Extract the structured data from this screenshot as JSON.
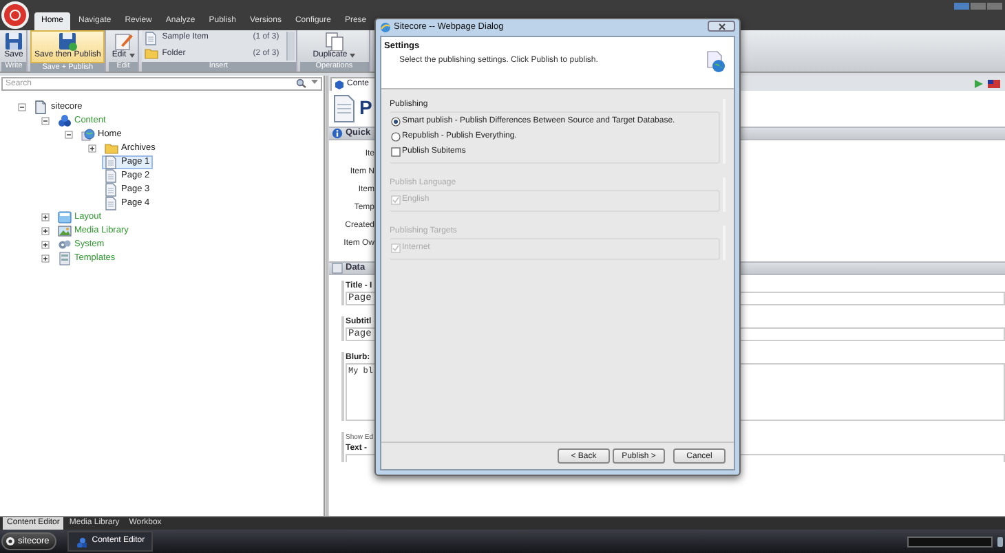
{
  "menu_tabs": [
    {
      "label": "Home",
      "selected": true
    },
    {
      "label": "Navigate",
      "selected": false
    },
    {
      "label": "Review",
      "selected": false
    },
    {
      "label": "Analyze",
      "selected": false
    },
    {
      "label": "Publish",
      "selected": false
    },
    {
      "label": "Versions",
      "selected": false
    },
    {
      "label": "Configure",
      "selected": false
    },
    {
      "label": "Prese",
      "selected": false
    }
  ],
  "ribbon": {
    "groups": [
      {
        "label": "Write",
        "kind": "large",
        "buttons": [
          {
            "label": "Save",
            "kind": "save",
            "highlighted": false
          }
        ]
      },
      {
        "label": "Save + Publish",
        "kind": "large",
        "buttons": [
          {
            "label": "Save then Publish",
            "kind": "savepublish",
            "highlighted": true
          }
        ]
      },
      {
        "label": "Edit",
        "kind": "large",
        "buttons": [
          {
            "label": "Edit",
            "kind": "edit",
            "highlighted": false
          }
        ]
      },
      {
        "label": "Insert",
        "kind": "list",
        "buttons": [
          {
            "label": "Sample Item",
            "count": "(1 of 3)",
            "kind": "page"
          },
          {
            "label": "Folder",
            "count": "(2 of 3)",
            "kind": "folder"
          }
        ]
      },
      {
        "label": "Operations",
        "kind": "large",
        "buttons": [
          {
            "label": "Duplicate",
            "kind": "duplicate",
            "highlighted": false
          }
        ]
      }
    ]
  },
  "search": {
    "placeholder": "Search"
  },
  "tree": [
    {
      "label": "sitecore",
      "kind": "root",
      "selected": false,
      "expanded": true,
      "children": [
        {
          "label": "Content",
          "kind": "content",
          "selected": false,
          "expanded": true,
          "children": [
            {
              "label": "Home",
              "kind": "home",
              "selected": false,
              "expanded": true,
              "children": [
                {
                  "label": "Archives",
                  "kind": "folder",
                  "selected": false,
                  "expanded": false
                },
                {
                  "label": "Page 1",
                  "kind": "page",
                  "selected": true
                },
                {
                  "label": "Page 2",
                  "kind": "page",
                  "selected": false
                },
                {
                  "label": "Page 3",
                  "kind": "page",
                  "selected": false
                },
                {
                  "label": "Page 4",
                  "kind": "page",
                  "selected": false
                }
              ]
            }
          ]
        },
        {
          "label": "Layout",
          "kind": "layout",
          "selected": false,
          "expanded": false
        },
        {
          "label": "Media Library",
          "kind": "media",
          "selected": false,
          "expanded": false
        },
        {
          "label": "System",
          "kind": "system",
          "selected": false,
          "expanded": false
        },
        {
          "label": "Templates",
          "kind": "templates",
          "selected": false,
          "expanded": false
        }
      ]
    }
  ],
  "editor": {
    "tab": "Conte",
    "item_title": "P",
    "quick_info": {
      "title": "Quick",
      "labels": [
        "Ite",
        "Item N",
        "Item",
        "Temp",
        "Created",
        "Item Ow"
      ]
    },
    "data": {
      "title": "Data",
      "fields": [
        {
          "kind": "text",
          "label": "Title - I",
          "value": "Page"
        },
        {
          "kind": "text",
          "label": "Subtitl",
          "value": "Page"
        },
        {
          "kind": "textarea",
          "label": "Blurb:",
          "value": "My bl"
        },
        {
          "kind": "rich",
          "note": "Show Ed",
          "label": "Text - "
        }
      ]
    }
  },
  "dialog": {
    "title": "Sitecore -- Webpage Dialog",
    "heading": "Settings",
    "description": "Select the publishing settings. Click Publish to publish.",
    "groups": [
      {
        "legend": "Publishing",
        "enabled": true,
        "options": [
          {
            "kind": "radio",
            "label": "Smart publish - Publish Differences Between Source and Target Database.",
            "checked": true
          },
          {
            "kind": "radio",
            "label": "Republish - Publish Everything.",
            "checked": false
          },
          {
            "kind": "checkbox",
            "label": "Publish Subitems",
            "checked": false
          }
        ]
      },
      {
        "legend": "Publish Language",
        "enabled": false,
        "options": [
          {
            "kind": "checkbox",
            "label": "English",
            "checked": true
          }
        ]
      },
      {
        "legend": "Publishing Targets",
        "enabled": false,
        "options": [
          {
            "kind": "checkbox",
            "label": "Internet",
            "checked": true
          }
        ]
      }
    ],
    "buttons": [
      "< Back",
      "Publish >",
      "Cancel"
    ]
  },
  "bottom_tabs": [
    {
      "label": "Content Editor",
      "selected": true
    },
    {
      "label": "Media Library",
      "selected": false
    },
    {
      "label": "Workbox",
      "selected": false
    }
  ],
  "taskbar": {
    "start": "sitecore",
    "items": [
      "Content Editor"
    ]
  }
}
